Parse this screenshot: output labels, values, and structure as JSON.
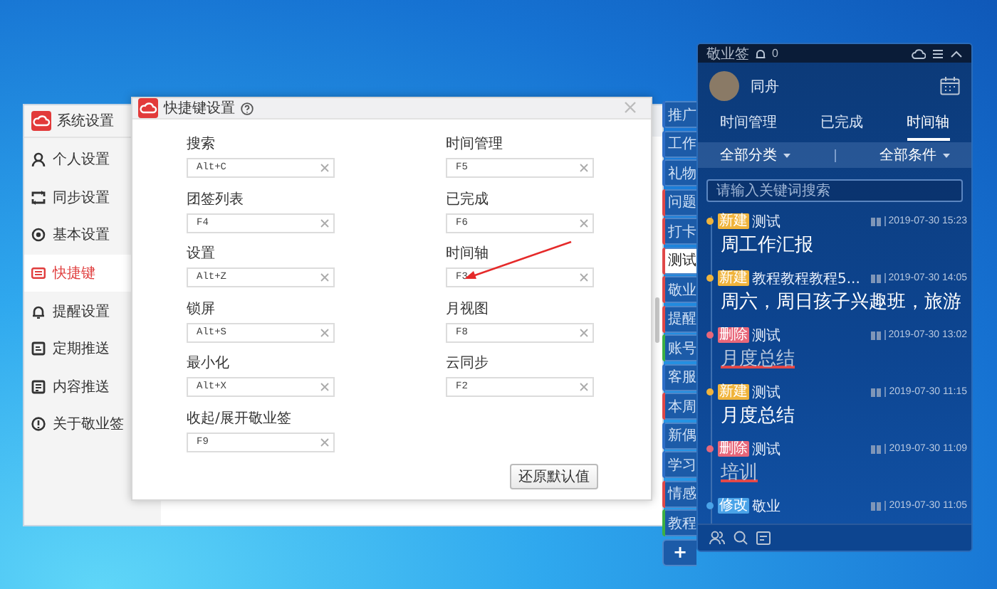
{
  "settings_window": {
    "title": "系统设置",
    "nav": [
      {
        "label": "个人设置",
        "selected": false
      },
      {
        "label": "同步设置",
        "selected": false
      },
      {
        "label": "基本设置",
        "selected": false
      },
      {
        "label": "快捷键",
        "selected": true
      },
      {
        "label": "提醒设置",
        "selected": false
      },
      {
        "label": "定期推送",
        "selected": false
      },
      {
        "label": "内容推送",
        "selected": false
      },
      {
        "label": "关于敬业签",
        "selected": false
      }
    ]
  },
  "shortcut_dialog": {
    "title": "快捷键设置",
    "columns": [
      [
        {
          "label": "搜索",
          "value": "Alt+C"
        },
        {
          "label": "团签列表",
          "value": "F4"
        },
        {
          "label": "设置",
          "value": "Alt+Z"
        },
        {
          "label": "锁屏",
          "value": "Alt+S"
        },
        {
          "label": "最小化",
          "value": "Alt+X"
        },
        {
          "label": "收起/展开敬业签",
          "value": "F9"
        }
      ],
      [
        {
          "label": "时间管理",
          "value": "F5"
        },
        {
          "label": "已完成",
          "value": "F6"
        },
        {
          "label": "时间轴",
          "value": "F3"
        },
        {
          "label": "月视图",
          "value": "F8"
        },
        {
          "label": "云同步",
          "value": "F2"
        }
      ]
    ],
    "reset_button": "还原默认值"
  },
  "side_tabs": [
    {
      "label": "推广",
      "color": "#2f6fc8",
      "selected": false
    },
    {
      "label": "工作",
      "color": "#2f6fc8",
      "selected": false
    },
    {
      "label": "礼物",
      "color": "#2f6fc8",
      "selected": false
    },
    {
      "label": "问题",
      "color": "#e04848",
      "selected": false
    },
    {
      "label": "打卡",
      "color": "#e04848",
      "selected": false
    },
    {
      "label": "测试",
      "color": "#e04848",
      "selected": true
    },
    {
      "label": "敬业",
      "color": "#e04848",
      "selected": false
    },
    {
      "label": "提醒",
      "color": "#e04848",
      "selected": false
    },
    {
      "label": "账号",
      "color": "#3cb043",
      "selected": false
    },
    {
      "label": "客服",
      "color": "#2f6fc8",
      "selected": false
    },
    {
      "label": "本周",
      "color": "#e04848",
      "selected": false
    },
    {
      "label": "新偶",
      "color": "#2f6fc8",
      "selected": false
    },
    {
      "label": "学习",
      "color": "#2f6fc8",
      "selected": false
    },
    {
      "label": "情感",
      "color": "#e04848",
      "selected": false
    },
    {
      "label": "教程",
      "color": "#3cb043",
      "selected": false
    }
  ],
  "add_tab": "+",
  "panel": {
    "app_name": "敬业签",
    "notifications": "0",
    "user": "同舟",
    "tabs": [
      {
        "label": "时间管理",
        "selected": false
      },
      {
        "label": "已完成",
        "selected": false
      },
      {
        "label": "时间轴",
        "selected": true
      }
    ],
    "filters": [
      "全部分类",
      "全部条件"
    ],
    "search": {
      "placeholder": "请输入关键词搜索"
    },
    "entries": [
      {
        "tag": "新建",
        "color": "#f0b43c",
        "category": "测试",
        "time": "2019-07-30 15:23",
        "title": "周工作汇报",
        "deleted": false
      },
      {
        "tag": "新建",
        "color": "#f0b43c",
        "category": "教程教程教程5...",
        "time": "2019-07-30 14:05",
        "title": "周六，周日孩子兴趣班，旅游",
        "deleted": false
      },
      {
        "tag": "删除",
        "color": "#e8677a",
        "category": "测试",
        "time": "2019-07-30 13:02",
        "title": "月度总结",
        "deleted": true
      },
      {
        "tag": "新建",
        "color": "#f0b43c",
        "category": "测试",
        "time": "2019-07-30 11:15",
        "title": "月度总结",
        "deleted": false
      },
      {
        "tag": "删除",
        "color": "#e8677a",
        "category": "测试",
        "time": "2019-07-30 11:09",
        "title": "培训",
        "deleted": true
      },
      {
        "tag": "修改",
        "color": "#4aa3e8",
        "category": "敬业",
        "time": "2019-07-30 11:05"
      }
    ]
  }
}
